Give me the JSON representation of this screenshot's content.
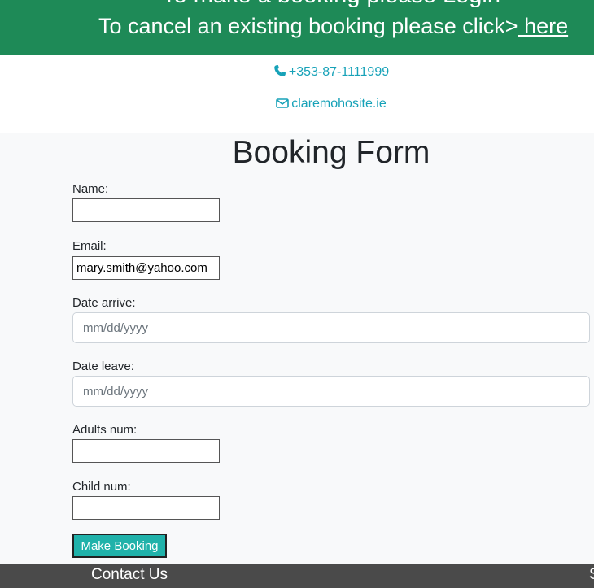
{
  "banner": {
    "line1": "To make a booking please Login",
    "line2_prefix": "To cancel an existing booking please click>",
    "line2_link": " here"
  },
  "contact": {
    "phone": "+353-87-1111999",
    "email": "claremohosite.ie"
  },
  "form": {
    "title": "Booking Form",
    "name_label": "Name:",
    "name_value": "",
    "email_label": "Email:",
    "email_value": "mary.smith@yahoo.com",
    "date_arrive_label": "Date arrive:",
    "date_arrive_placeholder": "mm/dd/yyyy",
    "date_leave_label": "Date leave:",
    "date_leave_placeholder": "mm/dd/yyyy",
    "adults_label": "Adults num:",
    "adults_value": "",
    "child_label": "Child num:",
    "child_value": "",
    "submit_label": "Make Booking"
  },
  "footer": {
    "contact_heading": "Contact Us",
    "cut_text": "S"
  },
  "colors": {
    "banner_bg": "#1e8a57",
    "link_accent": "#17a2b8",
    "button_bg": "#20b2aa",
    "footer_bg": "#4a4a4a"
  },
  "icons": {
    "phone": "phone-icon",
    "email": "envelope-icon"
  }
}
